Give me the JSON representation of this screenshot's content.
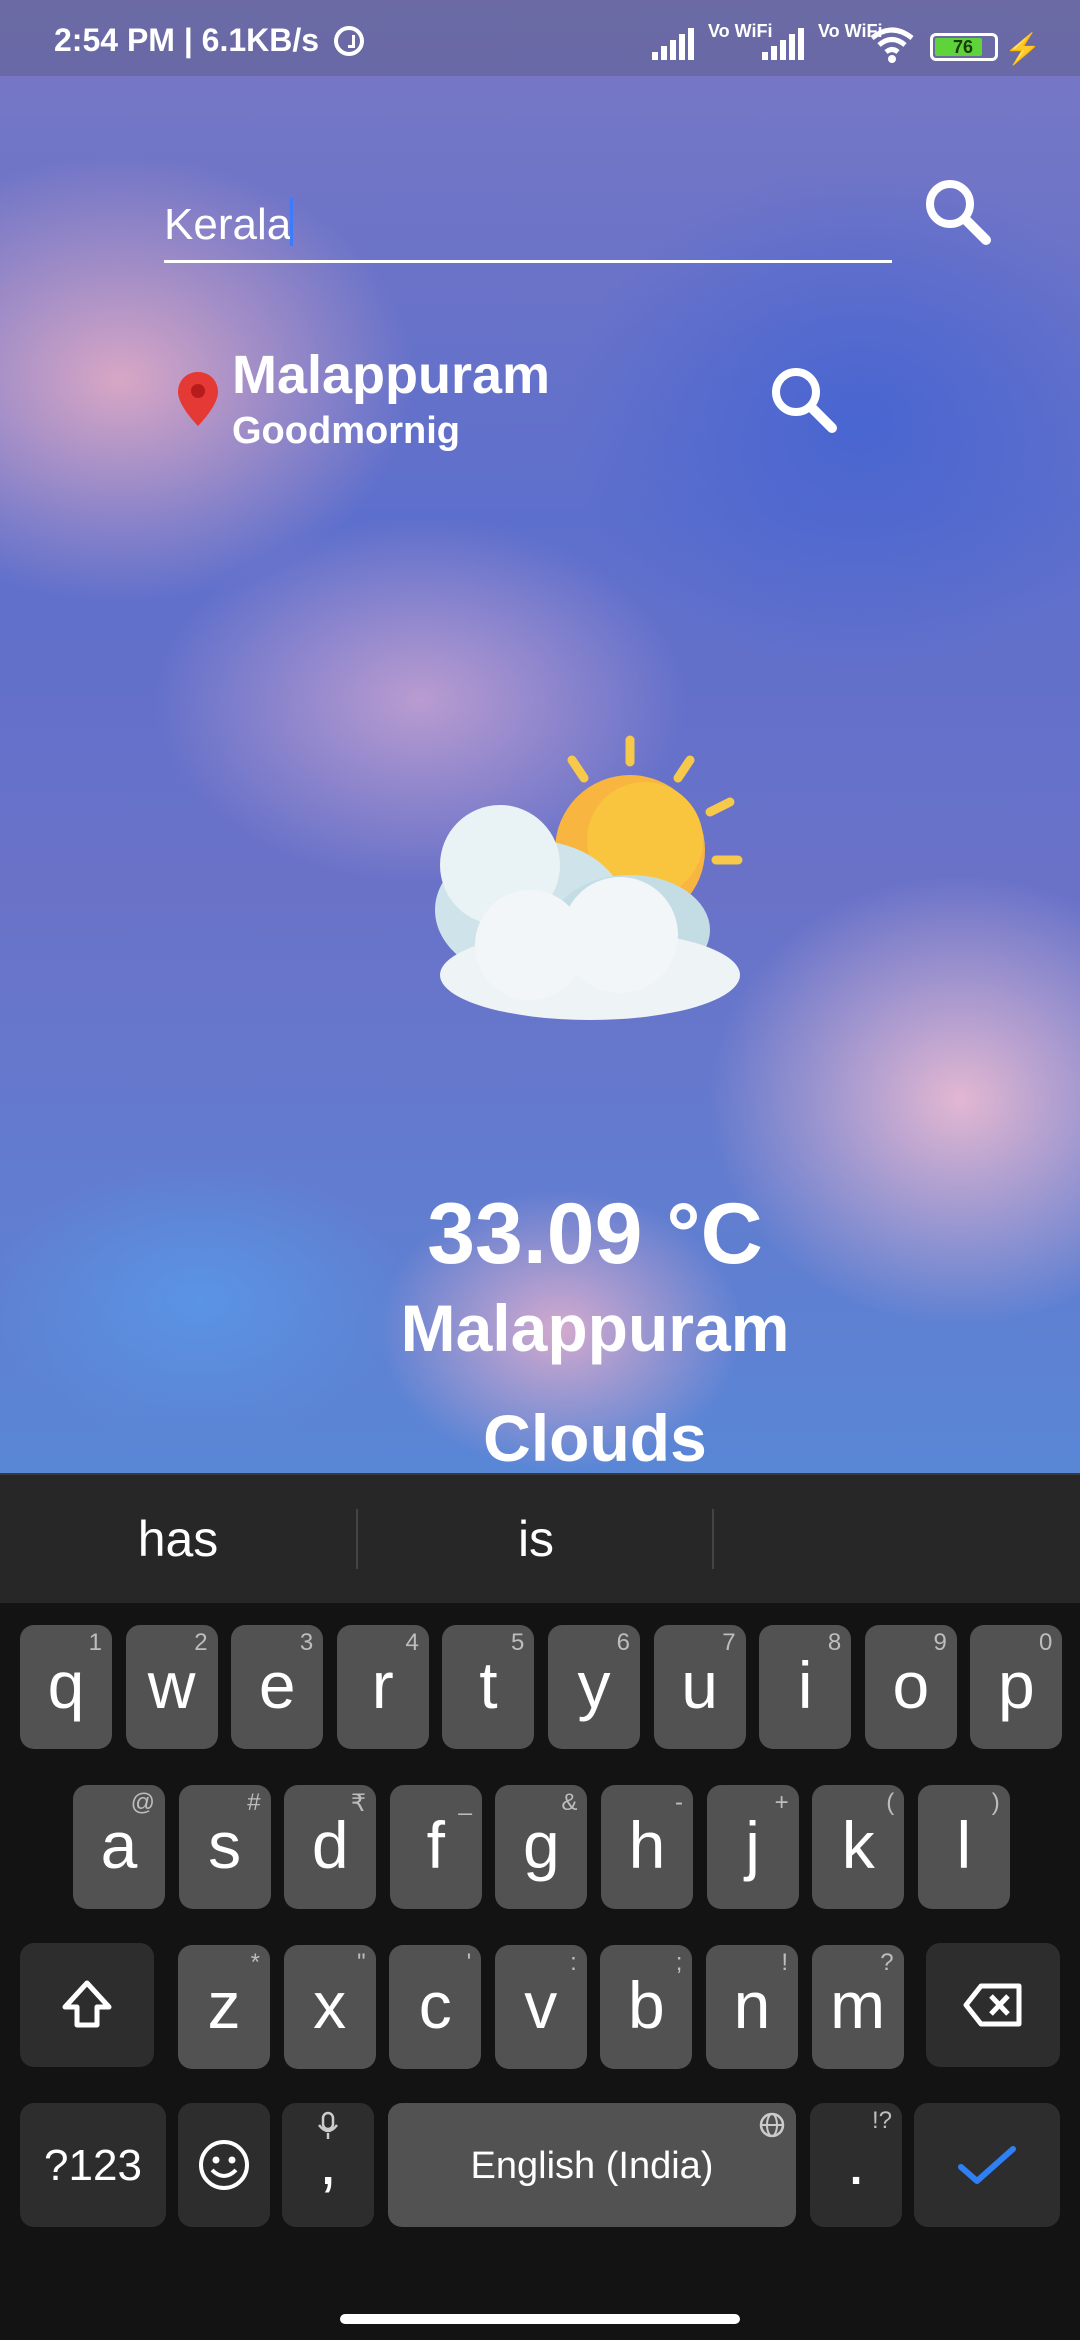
{
  "status_bar": {
    "time_speed": "2:54 PM | 6.1KB/s",
    "sim1_label": "Vo WiFi",
    "sim2_label": "Vo WiFi",
    "battery": "76",
    "icons": [
      "alarm-icon",
      "signal-icon",
      "wifi-icon",
      "battery-icon",
      "charging-icon"
    ]
  },
  "search": {
    "value": "Kerala"
  },
  "location": {
    "city": "Malappuram",
    "greeting": "Goodmornig"
  },
  "weather": {
    "icon": "partly-cloudy-icon",
    "temperature": "33.09 °C",
    "city": "Malappuram",
    "condition": "Clouds"
  },
  "keyboard": {
    "suggestions": [
      "has",
      "is",
      ""
    ],
    "row1": [
      {
        "k": "q",
        "h": "1"
      },
      {
        "k": "w",
        "h": "2"
      },
      {
        "k": "e",
        "h": "3"
      },
      {
        "k": "r",
        "h": "4"
      },
      {
        "k": "t",
        "h": "5"
      },
      {
        "k": "y",
        "h": "6"
      },
      {
        "k": "u",
        "h": "7"
      },
      {
        "k": "i",
        "h": "8"
      },
      {
        "k": "o",
        "h": "9"
      },
      {
        "k": "p",
        "h": "0"
      }
    ],
    "row2": [
      {
        "k": "a",
        "h": "@"
      },
      {
        "k": "s",
        "h": "#"
      },
      {
        "k": "d",
        "h": "₹"
      },
      {
        "k": "f",
        "h": "_"
      },
      {
        "k": "g",
        "h": "&"
      },
      {
        "k": "h",
        "h": "-"
      },
      {
        "k": "j",
        "h": "+"
      },
      {
        "k": "k",
        "h": "("
      },
      {
        "k": "l",
        "h": ")"
      }
    ],
    "row3": [
      {
        "k": "z",
        "h": "*"
      },
      {
        "k": "x",
        "h": "\""
      },
      {
        "k": "c",
        "h": "'"
      },
      {
        "k": "v",
        "h": ":"
      },
      {
        "k": "b",
        "h": ";"
      },
      {
        "k": "n",
        "h": "!"
      },
      {
        "k": "m",
        "h": "?"
      }
    ],
    "symbols_label": "?123",
    "comma_label": ",",
    "space_label": "English (India)",
    "period_label": ".",
    "period_hint": "!?"
  }
}
